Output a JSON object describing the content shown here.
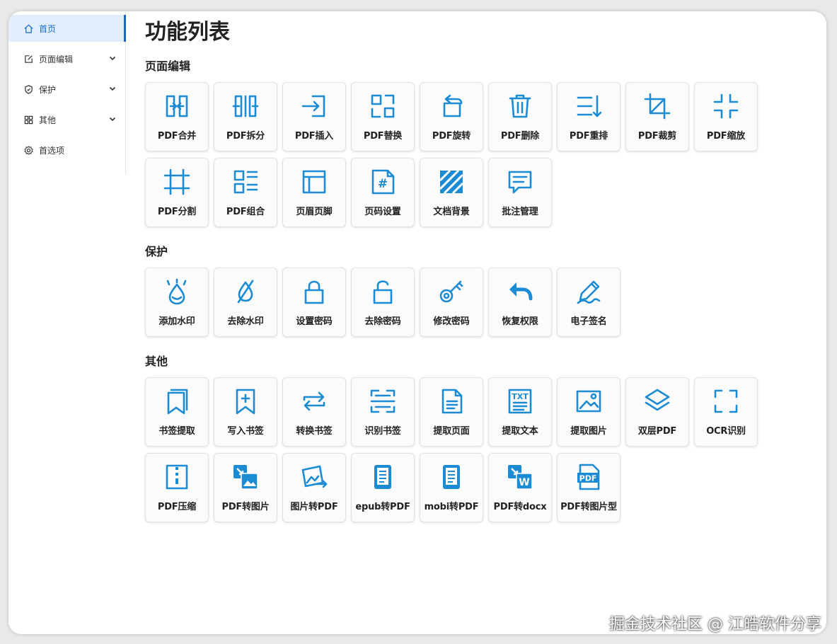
{
  "sidebar": {
    "items": [
      {
        "label": "首页",
        "icon": "home-icon",
        "active": true
      },
      {
        "label": "页面编辑",
        "icon": "edit-icon",
        "expandable": true
      },
      {
        "label": "保护",
        "icon": "shield-icon",
        "expandable": true
      },
      {
        "label": "其他",
        "icon": "grid-icon",
        "expandable": true
      },
      {
        "label": "首选项",
        "icon": "gear-icon"
      }
    ]
  },
  "main": {
    "title": "功能列表",
    "sections": [
      {
        "title": "页面编辑",
        "tiles": [
          {
            "label": "PDF合并",
            "icon": "merge-icon"
          },
          {
            "label": "PDF拆分",
            "icon": "split-icon"
          },
          {
            "label": "PDF插入",
            "icon": "insert-icon"
          },
          {
            "label": "PDF替换",
            "icon": "replace-icon"
          },
          {
            "label": "PDF旋转",
            "icon": "rotate-icon"
          },
          {
            "label": "PDF删除",
            "icon": "trash-icon"
          },
          {
            "label": "PDF重排",
            "icon": "reorder-icon"
          },
          {
            "label": "PDF裁剪",
            "icon": "crop-icon"
          },
          {
            "label": "PDF缩放",
            "icon": "shrink-icon"
          },
          {
            "label": "PDF分割",
            "icon": "cut-grid-icon"
          },
          {
            "label": "PDF组合",
            "icon": "combine-icon"
          },
          {
            "label": "页眉页脚",
            "icon": "header-footer-icon"
          },
          {
            "label": "页码设置",
            "icon": "page-number-icon"
          },
          {
            "label": "文档背景",
            "icon": "background-icon"
          },
          {
            "label": "批注管理",
            "icon": "comment-icon"
          }
        ]
      },
      {
        "title": "保护",
        "tiles": [
          {
            "label": "添加水印",
            "icon": "watermark-add-icon"
          },
          {
            "label": "去除水印",
            "icon": "watermark-remove-icon"
          },
          {
            "label": "设置密码",
            "icon": "lock-icon"
          },
          {
            "label": "去除密码",
            "icon": "unlock-icon"
          },
          {
            "label": "修改密码",
            "icon": "key-icon"
          },
          {
            "label": "恢复权限",
            "icon": "undo-icon"
          },
          {
            "label": "电子签名",
            "icon": "signature-icon"
          }
        ]
      },
      {
        "title": "其他",
        "tiles": [
          {
            "label": "书签提取",
            "icon": "bookmarks-icon"
          },
          {
            "label": "写入书签",
            "icon": "bookmark-add-icon"
          },
          {
            "label": "转换书签",
            "icon": "convert-icon"
          },
          {
            "label": "识别书签",
            "icon": "scan-icon"
          },
          {
            "label": "提取页面",
            "icon": "page-extract-icon"
          },
          {
            "label": "提取文本",
            "icon": "text-extract-icon"
          },
          {
            "label": "提取图片",
            "icon": "image-extract-icon"
          },
          {
            "label": "双层PDF",
            "icon": "layers-icon"
          },
          {
            "label": "OCR识别",
            "icon": "ocr-icon"
          },
          {
            "label": "PDF压缩",
            "icon": "zip-icon"
          },
          {
            "label": "PDF转图片",
            "icon": "pdf-to-image-icon"
          },
          {
            "label": "图片转PDF",
            "icon": "image-to-pdf-icon"
          },
          {
            "label": "epub转PDF",
            "icon": "epub-icon"
          },
          {
            "label": "mobi转PDF",
            "icon": "mobi-icon"
          },
          {
            "label": "PDF转docx",
            "icon": "word-icon"
          },
          {
            "label": "PDF转图片型",
            "icon": "pdf-file-icon"
          }
        ]
      }
    ]
  },
  "watermark": "掘金技术社区 @ 江皓软件分享",
  "colors": {
    "accent": "#1b8bd4",
    "sidebar_active_bg": "#e3eefc",
    "sidebar_active_text": "#1769c6"
  }
}
